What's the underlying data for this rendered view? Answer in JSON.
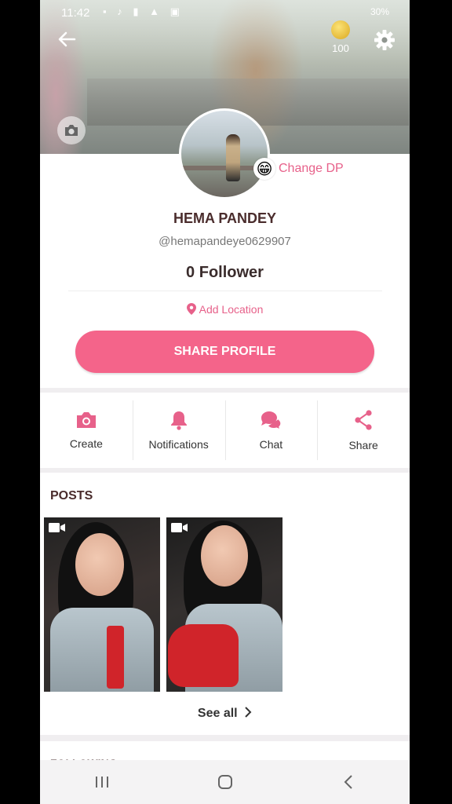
{
  "status_bar": {
    "time": "11:42",
    "right": "30%"
  },
  "header": {
    "coins": "100"
  },
  "profile": {
    "change_dp_label": "Change DP",
    "emoji": "😁",
    "name": "HEMA PANDEY",
    "handle": "@hemapandeye0629907",
    "followers": "0 Follower",
    "location_label": "Add Location",
    "share_button": "SHARE PROFILE"
  },
  "actions": [
    {
      "label": "Create",
      "icon": "camera-icon"
    },
    {
      "label": "Notifications",
      "icon": "bell-icon"
    },
    {
      "label": "Chat",
      "icon": "chat-bubbles-icon"
    },
    {
      "label": "Share",
      "icon": "share-icon"
    }
  ],
  "posts": {
    "title": "POSTS",
    "see_all": "See all",
    "items": [
      {
        "type": "video",
        "icon": "video-camera-icon"
      },
      {
        "type": "video",
        "icon": "video-camera-icon"
      }
    ]
  },
  "following": {
    "title": "FOLLOWING"
  },
  "colors": {
    "accent": "#f4648a",
    "accent_text": "#e7618a",
    "title_text": "#4a2c2c"
  }
}
